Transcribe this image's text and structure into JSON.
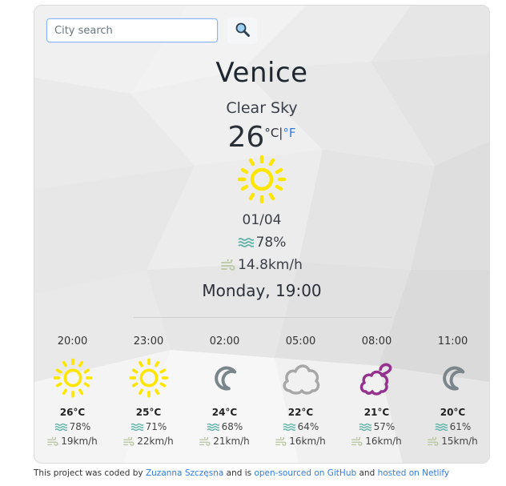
{
  "search": {
    "placeholder": "City search",
    "value": "",
    "button_icon": "magnifier-icon"
  },
  "current": {
    "city": "Venice",
    "description": "Clear Sky",
    "temperature": "26",
    "unit_celsius": "°C",
    "unit_separator": "|",
    "unit_fahrenheit": "°F",
    "icon": "sun-icon",
    "date": "01/04",
    "humidity": "78%",
    "humidity_icon": "waves-icon",
    "wind": "14.8km/h",
    "wind_icon": "wind-icon",
    "day_time": "Monday, 19:00"
  },
  "forecast": [
    {
      "time": "20:00",
      "icon": "sun-icon",
      "temp": "26°C",
      "humidity": "78%",
      "wind": "19km/h"
    },
    {
      "time": "23:00",
      "icon": "sun-icon",
      "temp": "25°C",
      "humidity": "71%",
      "wind": "22km/h"
    },
    {
      "time": "02:00",
      "icon": "moon-icon",
      "temp": "24°C",
      "humidity": "68%",
      "wind": "21km/h"
    },
    {
      "time": "05:00",
      "icon": "cloud-icon",
      "temp": "22°C",
      "humidity": "64%",
      "wind": "16km/h"
    },
    {
      "time": "08:00",
      "icon": "cloudy-night-icon",
      "temp": "21°C",
      "humidity": "57%",
      "wind": "16km/h"
    },
    {
      "time": "11:00",
      "icon": "moon-icon",
      "temp": "20°C",
      "humidity": "61%",
      "wind": "15km/h"
    }
  ],
  "footer": {
    "text1": "This project was coded by ",
    "author_link": "Zuzanna Szczęsna",
    "text2": " and is ",
    "github_link": "open-sourced on GitHub",
    "text3": " and ",
    "netlify_link": "hosted on Netlify"
  },
  "colors": {
    "accent": "#2f7de1",
    "sun": "#ffe600",
    "moon": "#7b868c",
    "cloud": "#a7a7a7",
    "cloudy_night": "#93338f",
    "humidity_icon": "#5fb3a8",
    "wind_icon": "#b9c7a3"
  }
}
